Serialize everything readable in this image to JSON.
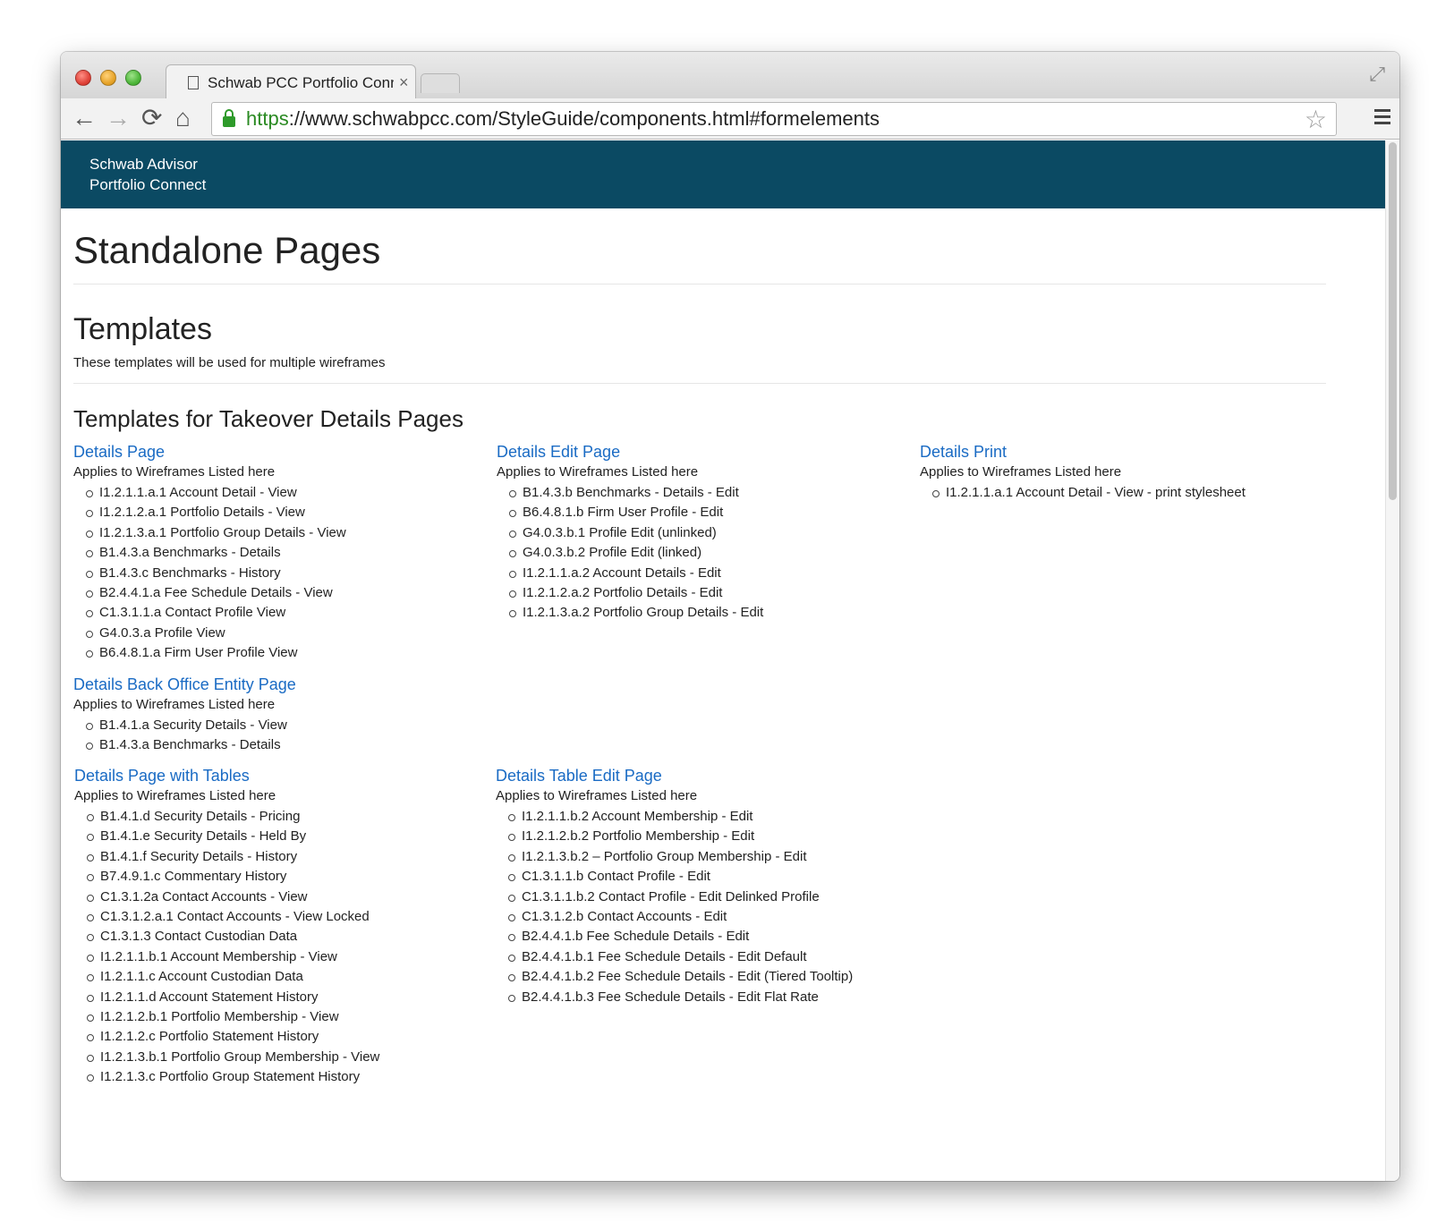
{
  "browser": {
    "tab_title": "Schwab PCC Portfolio Conn",
    "tab_close": "×",
    "url_scheme": "https",
    "url_rest": "://www.schwabpcc.com/StyleGuide/components.html#formelements",
    "icons": {
      "back": "back-arrow-icon",
      "forward": "forward-arrow-icon",
      "reload": "reload-icon",
      "home": "home-icon",
      "bookmark": "star-icon",
      "menu": "hamburger-icon"
    },
    "glyphs": {
      "back": "←",
      "forward": "→",
      "reload": "⟳",
      "home": "⌂",
      "star": "☆",
      "fullscreen": "⤢"
    }
  },
  "site_header": {
    "line1": "Schwab Advisor",
    "line2": "Portfolio Connect",
    "bg_color": "#0b4a63"
  },
  "page": {
    "title": "Standalone Pages",
    "section_title": "Templates",
    "section_intro": "These templates will be used for multiple wireframes",
    "subsection_title": "Templates for Takeover Details Pages",
    "link_color": "#1a6bc4"
  },
  "templates": [
    {
      "title": "Details Page",
      "applies": "Applies to Wireframes Listed here",
      "items": [
        "I1.2.1.1.a.1 Account Detail - View",
        "I1.2.1.2.a.1 Portfolio Details - View",
        "I1.2.1.3.a.1 Portfolio Group Details - View",
        "B1.4.3.a Benchmarks - Details",
        "B1.4.3.c Benchmarks - History",
        "B2.4.4.1.a Fee Schedule Details - View",
        "C1.3.1.1.a Contact Profile View",
        "G4.0.3.a Profile View",
        "B6.4.8.1.a Firm User Profile View"
      ]
    },
    {
      "title": "Details Edit Page",
      "applies": "Applies to Wireframes Listed here",
      "items": [
        "B1.4.3.b Benchmarks - Details - Edit",
        "B6.4.8.1.b Firm User Profile - Edit",
        "G4.0.3.b.1 Profile Edit (unlinked)",
        "G4.0.3.b.2 Profile Edit (linked)",
        "I1.2.1.1.a.2 Account Details - Edit",
        "I1.2.1.2.a.2 Portfolio Details - Edit",
        "I1.2.1.3.a.2 Portfolio Group Details - Edit"
      ]
    },
    {
      "title": "Details Print",
      "applies": "Applies to Wireframes Listed here",
      "items": [
        "I1.2.1.1.a.1 Account Detail - View - print stylesheet"
      ]
    },
    {
      "title": "Details Back Office Entity Page",
      "applies": "Applies to Wireframes Listed here",
      "items": [
        "B1.4.1.a Security Details - View",
        "B1.4.3.a Benchmarks - Details"
      ]
    },
    {
      "title": "Details Page with Tables",
      "applies": "Applies to Wireframes Listed here",
      "items": [
        "B1.4.1.d Security Details - Pricing",
        "B1.4.1.e Security Details - Held By",
        "B1.4.1.f Security Details - History",
        "B7.4.9.1.c Commentary History",
        "C1.3.1.2a Contact Accounts - View",
        "C1.3.1.2.a.1 Contact Accounts - View Locked",
        "C1.3.1.3 Contact Custodian Data",
        "I1.2.1.1.b.1 Account Membership - View",
        "I1.2.1.1.c Account Custodian Data",
        "I1.2.1.1.d Account Statement History",
        "I1.2.1.2.b.1 Portfolio Membership - View",
        "I1.2.1.2.c Portfolio Statement History",
        "I1.2.1.3.b.1 Portfolio Group Membership - View",
        "I1.2.1.3.c Portfolio Group Statement History"
      ]
    },
    {
      "title": "Details Table Edit Page",
      "applies": "Applies to Wireframes Listed here",
      "items": [
        "I1.2.1.1.b.2 Account Membership - Edit",
        "I1.2.1.2.b.2 Portfolio Membership - Edit",
        "I1.2.1.3.b.2 – Portfolio Group Membership - Edit",
        "C1.3.1.1.b Contact Profile - Edit",
        "C1.3.1.1.b.2 Contact Profile - Edit Delinked Profile",
        "C1.3.1.2.b Contact Accounts - Edit",
        "B2.4.4.1.b Fee Schedule Details - Edit",
        "B2.4.4.1.b.1 Fee Schedule Details - Edit Default",
        "B2.4.4.1.b.2 Fee Schedule Details - Edit (Tiered Tooltip)",
        "B2.4.4.1.b.3 Fee Schedule Details - Edit Flat Rate"
      ]
    }
  ]
}
